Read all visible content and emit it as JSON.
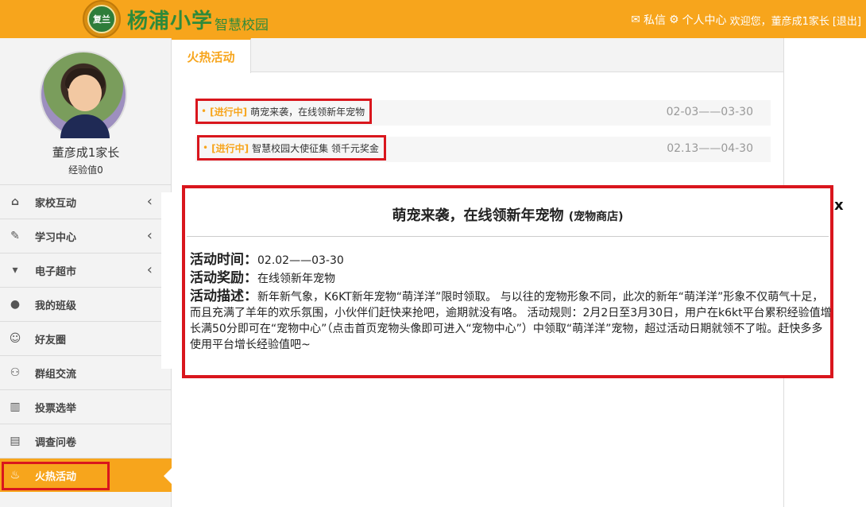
{
  "header": {
    "seal_text": "复兰",
    "school_name": "杨浦小学",
    "school_sub": "智慧校园",
    "message_label": "私信",
    "personal_center_label": "个人中心",
    "welcome_text": "欢迎您，董彦成1家长",
    "logout_label": "[退出]"
  },
  "profile": {
    "name": "董彦成1家长",
    "experience": "经验值0"
  },
  "menu": {
    "items": [
      {
        "label": "家校互动",
        "icon": "home-icon",
        "chevron": "‹"
      },
      {
        "label": "学习中心",
        "icon": "edit-icon",
        "chevron": "‹"
      },
      {
        "label": "电子超市",
        "icon": "cart-icon",
        "chevron": "‹"
      },
      {
        "label": "我的班级",
        "icon": "user-icon"
      },
      {
        "label": "好友圈",
        "icon": "smile-icon"
      },
      {
        "label": "群组交流",
        "icon": "group-icon"
      },
      {
        "label": "投票选举",
        "icon": "bar-chart-icon"
      },
      {
        "label": "调查问卷",
        "icon": "document-icon"
      },
      {
        "label": "火热活动",
        "icon": "fire-icon"
      }
    ],
    "active_color": "#f7a51c"
  },
  "tabs": {
    "active": "火热活动"
  },
  "activities": [
    {
      "status": "[进行中]",
      "title": "萌宠来袭，在线领新年宠物",
      "dates": "02-03——03-30"
    },
    {
      "status": "[进行中]",
      "title": "智慧校园大使征集 领千元奖金",
      "dates": "02.13——04-30"
    }
  ],
  "modal": {
    "title": "萌宠来袭，在线领新年宠物",
    "title_tag": "(宠物商店)",
    "time_label": "活动时间：",
    "time_value": "02.02——03-30",
    "reward_label": "活动奖励：",
    "reward_value": "在线领新年宠物",
    "desc_label": "活动描述：",
    "desc_value": "新年新气象，K6KT新年宠物“萌洋洋”限时领取。 与以往的宠物形象不同，此次的新年“萌洋洋”形象不仅萌气十足，而且充满了羊年的欢乐氛围，小伙伴们赶快来抢吧，逾期就没有咯。 活动规则：2月2日至3月30日，用户在k6kt平台累积经验值增长满50分即可在“宠物中心”（点击首页宠物头像即可进入“宠物中心”）中领取“萌洋洋”宠物，超过活动日期就领不了啦。赶快多多使用平台增长经验值吧~",
    "close_label": "x"
  },
  "colors": {
    "brand_orange": "#f7a51c",
    "school_green": "#2f8a3a",
    "highlight_red": "#d9161d"
  }
}
